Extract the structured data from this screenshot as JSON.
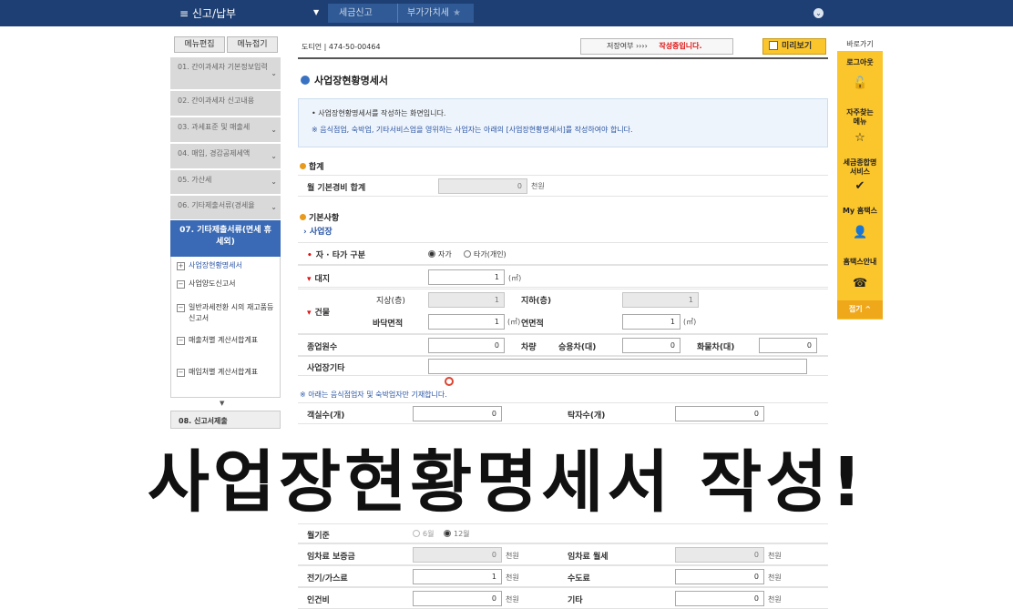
{
  "topbar": {
    "menu": "≡  신고/납부",
    "dropdown": "▼",
    "tab1": "세금신고",
    "tab2": "부가가치세",
    "star": "★",
    "circle": "⌄"
  },
  "sidebar": {
    "btn_edit": "메뉴편집",
    "btn_fold": "메뉴접기",
    "items": [
      {
        "label": "01. 간이과세자 기본정보입력"
      },
      {
        "label": "02. 간이과세자 신고내용"
      },
      {
        "label": "03. 과세표준 및 매출세"
      },
      {
        "label": "04. 매입, 경감공제세액"
      },
      {
        "label": "05. 가산세"
      },
      {
        "label": "06. 기타제출서류(경세율"
      }
    ],
    "active": "07. 기타제출서류(면세 휴세외)",
    "subitems": [
      {
        "label": "사업장현황명세서"
      },
      {
        "label": "사업양도신고서"
      },
      {
        "label": "일반과세전환 시의 재고품등 신고서"
      },
      {
        "label": "매출처별 계산서합계표"
      },
      {
        "label": "매입처별 계산서합계표"
      }
    ],
    "arrow": "▼",
    "last": "08. 신고서제출"
  },
  "header": {
    "name": "도티언   |   474-50-00464",
    "status_prefix": "저장여부  ›››› ",
    "status": "작성중입니다.",
    "preview": "미리보기"
  },
  "page": {
    "title": "사업장현황명세서",
    "info1": "• 사업장현황명세서를 작성하는 화면입니다.",
    "info2": "※ 음식점업, 숙박업, 기타서비스업을 영위하는 사업자는 아래의 [사업장현황명세서]를 작성하여야 합니다."
  },
  "section_sum": {
    "title": "합계",
    "label": "월 기본경비 합계",
    "value": "0",
    "unit": "천원"
  },
  "section_basic": {
    "title": "기본사항",
    "sub": "› 사업장",
    "owner_label": "자 · 타가 구분",
    "owner_opt1": "자가",
    "owner_opt2": "타가(개인)",
    "land_label": "대지",
    "land_value": "1",
    "land_unit": "(㎡)",
    "bldg_label": "건물",
    "above_label": "지상(층)",
    "above_value": "1",
    "below_label": "지하(층)",
    "below_value": "1",
    "floor_label": "바닥면적",
    "floor_value": "1",
    "floor_unit": "(㎡)",
    "total_label": "연면적",
    "total_value": "1",
    "total_unit": "(㎡)",
    "emp_label": "종업원수",
    "emp_value": "0",
    "veh_label": "차량",
    "car_label": "승용차(대)",
    "car_value": "0",
    "truck_label": "화물차(대)",
    "truck_value": "0",
    "etc_label": "사업장기타",
    "etc_value": ""
  },
  "note_food": "※ 아래는 음식점업자 및 숙박업자만 기재합니다.",
  "food": {
    "seat_label": "객실수(개)",
    "seat_value": "0",
    "table_label": "탁자수(개)",
    "table_value": "0"
  },
  "overlay": "사업장현황명세서 작성!",
  "cost": {
    "basis_label": "월기준",
    "basis_opt1": "6월",
    "basis_opt2": "12월",
    "deposit_label": "임차료 보증금",
    "deposit_value": "0",
    "deposit_unit": "천원",
    "monthly_label": "임차료 월세",
    "monthly_value": "0",
    "monthly_unit": "천원",
    "elec_label": "전기/가스료",
    "elec_value": "1",
    "elec_unit": "천원",
    "water_label": "수도료",
    "water_value": "0",
    "water_unit": "천원",
    "labor_label": "인건비",
    "labor_value": "0",
    "labor_unit": "천원",
    "other_label": "기타",
    "other_value": "0",
    "other_unit": "천원"
  },
  "rpanel": {
    "head": "바로가기",
    "items": [
      {
        "label": "로그아웃",
        "icon": "🔓"
      },
      {
        "label": "자주찾는 메뉴",
        "icon": "☆"
      },
      {
        "label": "세금종합명 서비스",
        "icon": "✔"
      },
      {
        "label": "My 홈택스",
        "icon": "👤"
      },
      {
        "label": "홈택스안내",
        "icon": "☎"
      }
    ],
    "close": "접기 ^"
  }
}
